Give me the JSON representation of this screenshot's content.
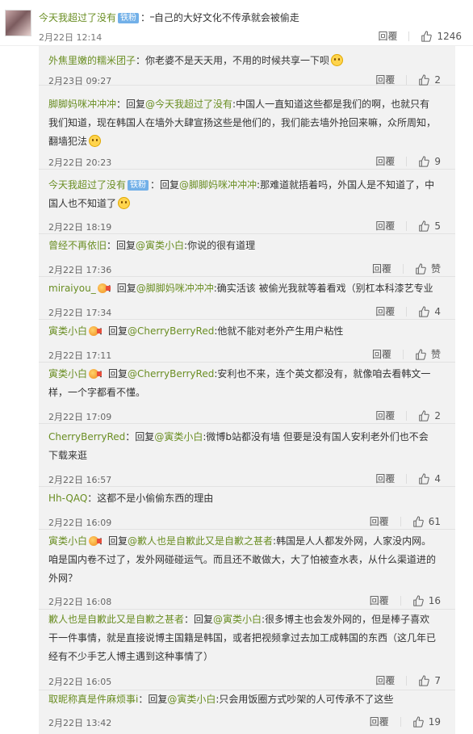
{
  "main_comment": {
    "user": "今天我超过了没有",
    "badge": "铁粉",
    "text": "：᠆自己的大好文化不传承就会被偷走",
    "time": "2月22日 12:14",
    "reply_label": "回覆",
    "likes": "1246"
  },
  "replies": [
    {
      "user": "外焦里嫩的糯米团子",
      "text": "：你老婆不是天天用，不用的时候共享一下呗",
      "time": "2月23日 09:27",
      "reply_label": "回覆",
      "likes": "2"
    },
    {
      "user": "脚脚妈咪冲冲冲",
      "prefix": "：回复",
      "target": "@今天我超过了没有",
      "text": ":中国人一直知道这些都是我们的啊，也就只有我们知道，现在韩国人在墙外大肆宣扬这些是他们的，我们能去墙外抢回来嘛，众所周知，翻墙犯法",
      "time": "2月22日 20:23",
      "reply_label": "回覆",
      "likes": "9"
    },
    {
      "user": "今天我超过了没有",
      "badge": "铁粉",
      "prefix": "：回复",
      "target": "@脚脚妈咪冲冲冲",
      "text": ":那难道就捂着吗，外国人是不知道了，中国人也不知道了",
      "time": "2月22日 18:19",
      "reply_label": "回覆",
      "likes": "5"
    },
    {
      "user": "曾经不再依旧",
      "prefix": "：回复",
      "target": "@寅类小白",
      "text": ":你说的很有道理",
      "time": "2月22日 17:36",
      "reply_label": "回覆",
      "likes": "赞"
    },
    {
      "user": "miraiyou_",
      "prefix": "：回复",
      "target": "@脚脚妈咪冲冲冲",
      "text": ":确实活该 被偷光我就等着看戏（别杠本科漆艺专业",
      "time": "2月22日 17:34",
      "reply_label": "回覆",
      "likes": "4"
    },
    {
      "user": "寅类小白",
      "prefix": "：回复",
      "target": "@CherryBerryRed",
      "text": ":他就不能对老外产生用户粘性",
      "time": "2月22日 17:11",
      "reply_label": "回覆",
      "likes": "赞"
    },
    {
      "user": "寅类小白",
      "prefix": "：回复",
      "target": "@CherryBerryRed",
      "text": ":安利也不来，连个英文都没有，就像咱去看韩文一样，一个字都看不懂。",
      "time": "2月22日 17:09",
      "reply_label": "回覆",
      "likes": "2"
    },
    {
      "user": "CherryBerryRed",
      "prefix": "：回复",
      "target": "@寅类小白",
      "text": ":微博b站都没有墙 但要是没有国人安利老外们也不会下载来逛",
      "time": "2月22日 16:57",
      "reply_label": "回覆",
      "likes": "4"
    },
    {
      "user": "Hh-QAQ",
      "text": "：这都不是小偷偷东西的理由",
      "time": "2月22日 16:09",
      "reply_label": "回覆",
      "likes": "61"
    },
    {
      "user": "寅类小白",
      "prefix": "：回复",
      "target": "@歉人也是自歉此又是自歉之甚者",
      "text": ":韩国是人人都发外网，人家没内网。咱是国内卷不过了，发外网碰碰运气。而且还不敢做大，大了怕被查水表，从什么渠道进的外网？",
      "time": "2月22日 16:08",
      "reply_label": "回覆",
      "likes": "16"
    },
    {
      "user": "歉人也是自歉此又是自歉之甚者",
      "prefix": "：回复",
      "target": "@寅类小白",
      "text": ":很多博主也会发外网的，但是棒子喜欢干一件事情，就是直接说博主国籍是韩国，或者把视频拿过去加工成韩国的东西（这几年已经有不少手艺人博主遇到这种事情了）",
      "time": "2月22日 16:05",
      "reply_label": "回覆",
      "likes": "7"
    },
    {
      "user": "取昵称真是件麻烦事i",
      "prefix": "：回复",
      "target": "@寅类小白",
      "text": ":只会用饭圈方式吵架的人可传承不了这些",
      "time": "2月22日 13:42",
      "reply_label": "回覆",
      "likes": "19"
    }
  ]
}
